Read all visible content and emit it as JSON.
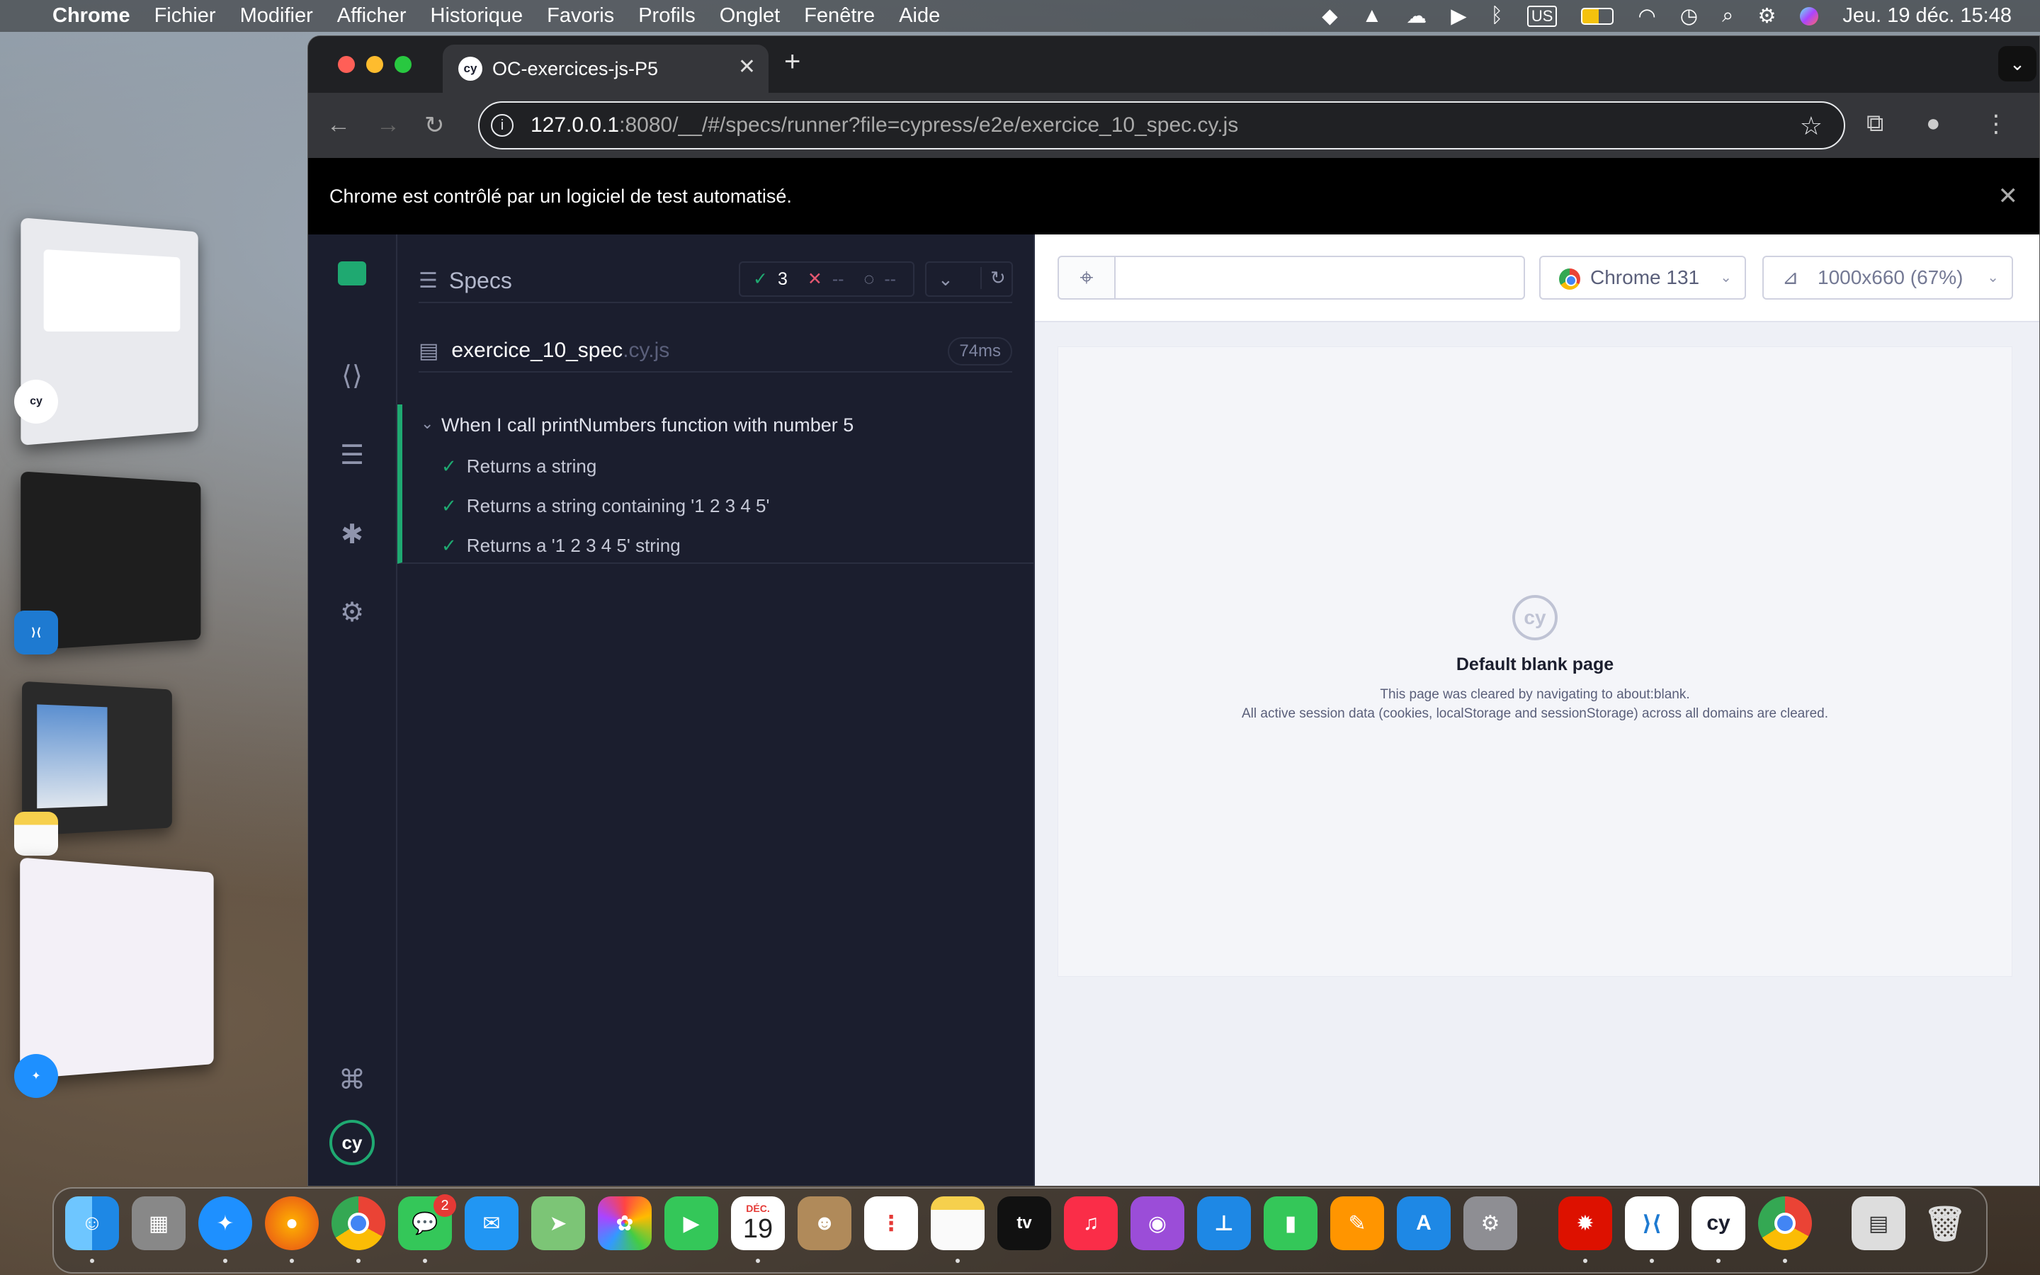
{
  "menubar": {
    "app": "Chrome",
    "items": [
      "Fichier",
      "Modifier",
      "Afficher",
      "Historique",
      "Favoris",
      "Profils",
      "Onglet",
      "Fenêtre",
      "Aide"
    ],
    "clock": "Jeu. 19 déc.  15:48",
    "keyboard": "US"
  },
  "browser": {
    "tab_title": "OC-exercices-js-P5",
    "url_host": "127.0.0.1",
    "url_port": ":8080/",
    "url_path": "__/#/specs/runner?file=cypress/e2e/exercice_10_spec.cy.js",
    "automation_banner": "Chrome est contrôlé par un logiciel de test automatisé."
  },
  "reporter": {
    "title": "Specs",
    "passed": "3",
    "failed": "--",
    "pending": "--",
    "spec_name": "exercice_10_spec",
    "spec_ext": ".cy.js",
    "duration": "74ms",
    "suite": "When I call printNumbers function with number 5",
    "tests": [
      "Returns a string",
      "Returns a string containing '1 2 3 4 5'",
      "Returns a '1 2 3 4 5' string"
    ]
  },
  "aut": {
    "browser_label": "Chrome 131",
    "viewport_label": "1000x660 (67%)",
    "blank_title": "Default blank page",
    "blank_line1": "This page was cleared by navigating to about:blank.",
    "blank_line2": "All active session data (cookies, localStorage and sessionStorage) across all domains are cleared.",
    "logo_text": "cy"
  },
  "dock": {
    "calendar_month": "DÉC.",
    "calendar_day": "19",
    "messages_badge": "2"
  },
  "colors": {
    "pass": "#1fa971",
    "fail": "#e45770",
    "reporter_bg": "#1b1e2e"
  }
}
